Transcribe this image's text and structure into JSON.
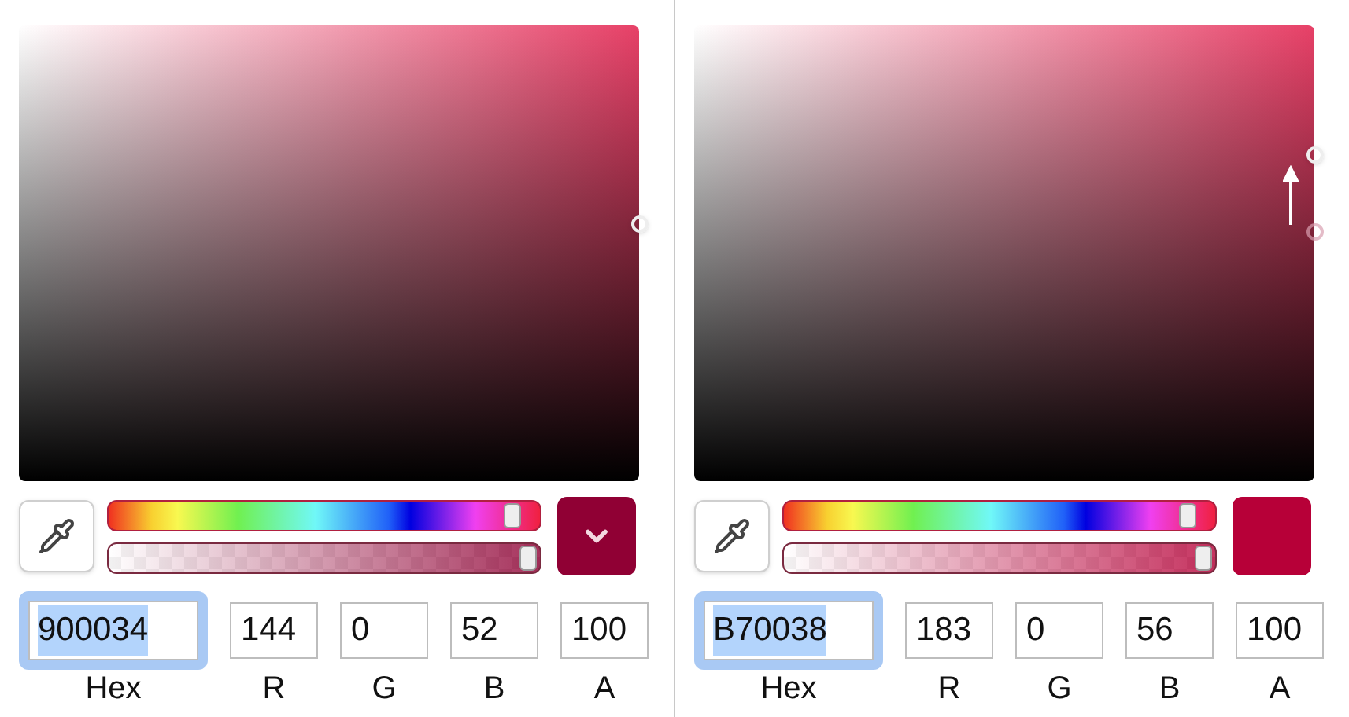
{
  "panels": [
    {
      "hue": {
        "level": 0.96
      },
      "alpha": {
        "level": 1
      },
      "swatch": {
        "kind": "menu",
        "color": "#900034"
      },
      "fields": [
        {
          "label": "Hex",
          "value": "900034",
          "focused": true
        },
        {
          "label": "R",
          "value": "144",
          "focused": false
        },
        {
          "label": "G",
          "value": "0",
          "focused": false
        },
        {
          "label": "B",
          "value": "52",
          "focused": false
        },
        {
          "label": "A",
          "value": "100",
          "focused": false
        }
      ]
    },
    {
      "picker": {
        "dragging": true
      },
      "hue": {
        "level": 0.96
      },
      "alpha": {
        "level": 1
      },
      "swatch": {
        "kind": "plain",
        "color": "#b70038"
      },
      "fields": [
        {
          "label": "Hex",
          "value": "B70038",
          "focused": true
        },
        {
          "label": "R",
          "value": "183",
          "focused": false
        },
        {
          "label": "G",
          "value": "0",
          "focused": false
        },
        {
          "label": "B",
          "value": "56",
          "focused": false
        },
        {
          "label": "A",
          "value": "100",
          "focused": false
        }
      ]
    }
  ]
}
